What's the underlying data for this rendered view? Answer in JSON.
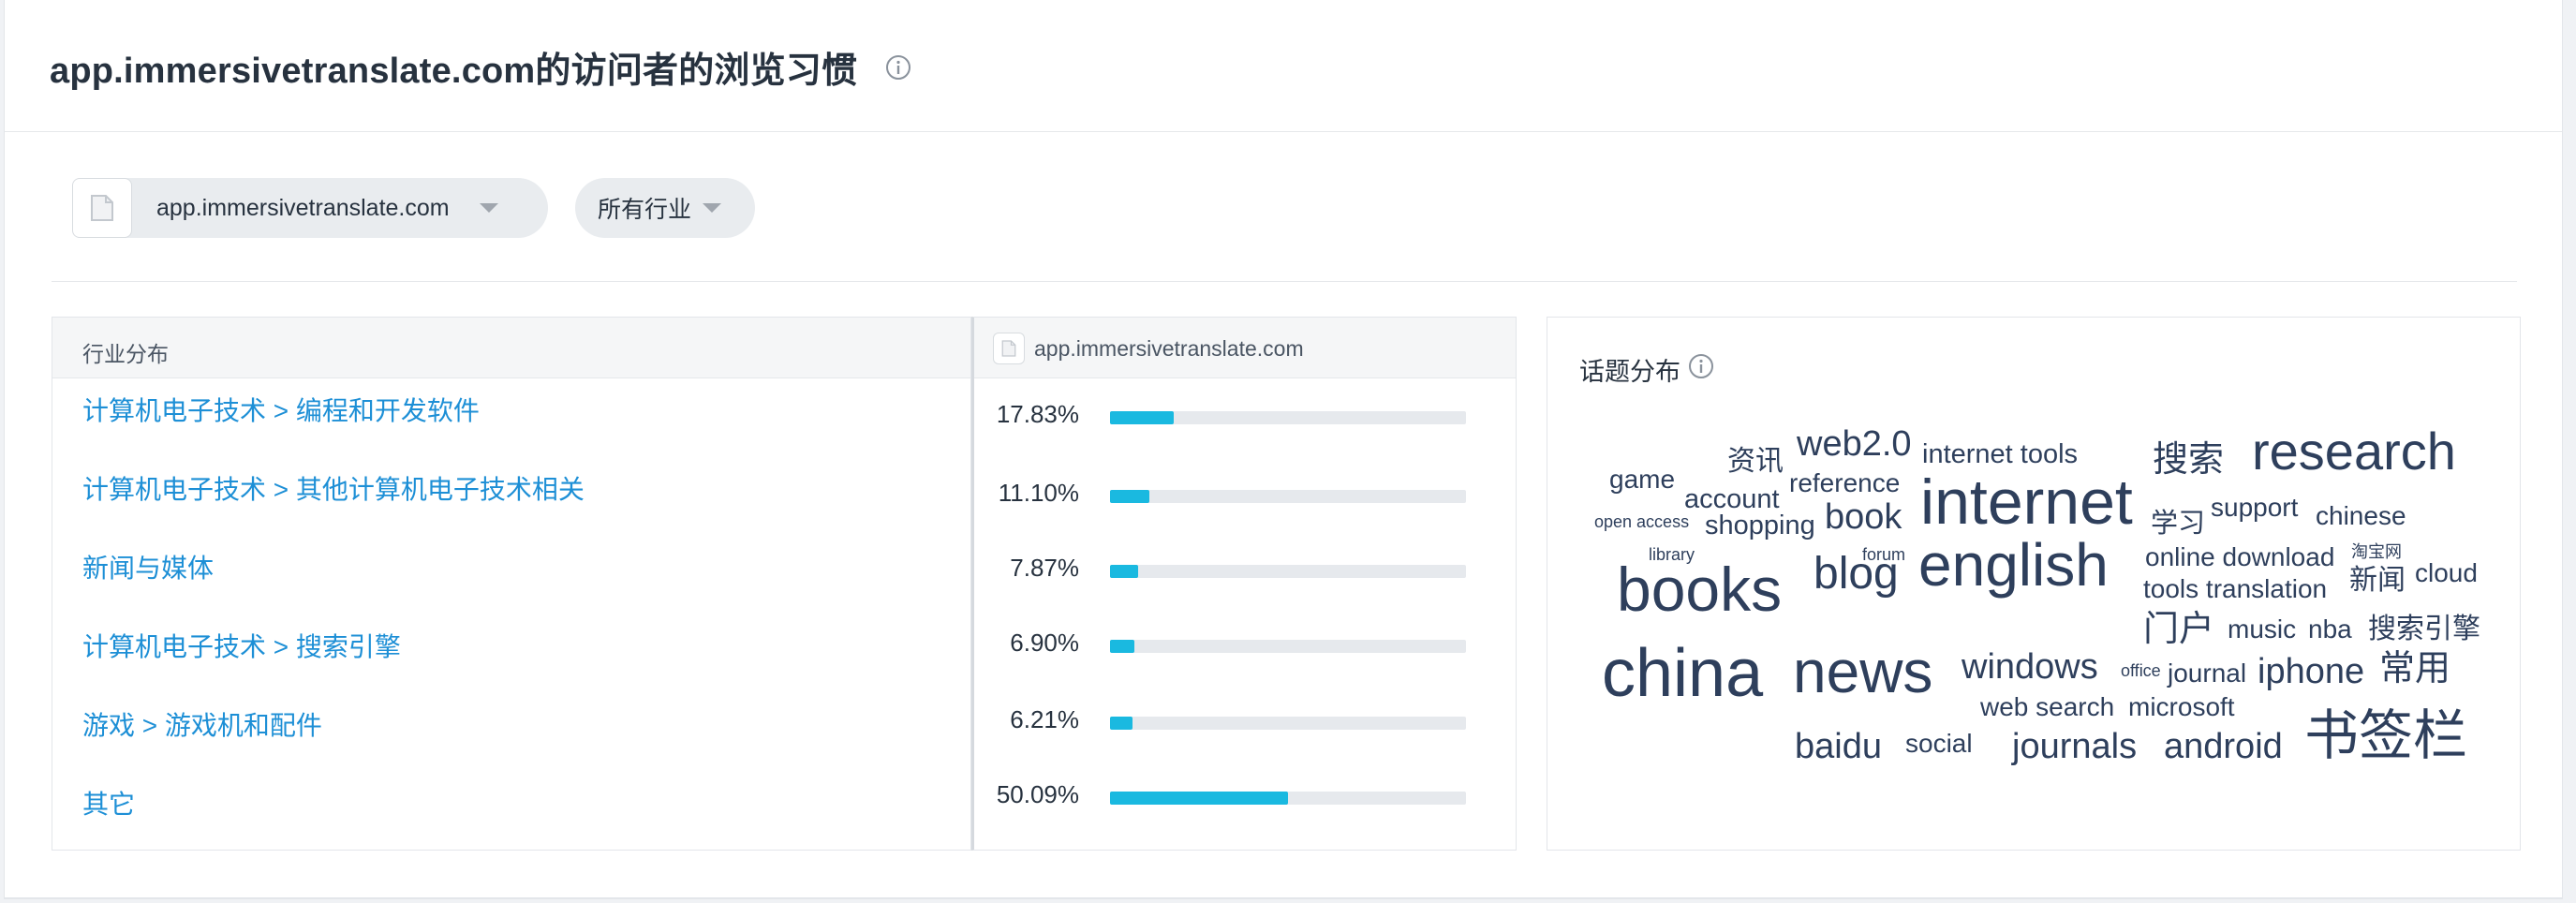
{
  "header": {
    "title": "app.immersivetranslate.com的访问者的浏览习惯"
  },
  "filters": {
    "site_select": "app.immersivetranslate.com",
    "industry_select": "所有行业"
  },
  "table": {
    "col_industry": "行业分布",
    "col_site": "app.immersivetranslate.com",
    "rows": [
      {
        "label": "计算机电子技术 > 编程和开发软件",
        "pct": "17.83%",
        "value": 17.83
      },
      {
        "label": "计算机电子技术 > 其他计算机电子技术相关",
        "pct": "11.10%",
        "value": 11.1
      },
      {
        "label": "新闻与媒体",
        "pct": "7.87%",
        "value": 7.87
      },
      {
        "label": "计算机电子技术 > 搜索引擎",
        "pct": "6.90%",
        "value": 6.9
      },
      {
        "label": "游戏 > 游戏机和配件",
        "pct": "6.21%",
        "value": 6.21
      },
      {
        "label": "其它",
        "pct": "50.09%",
        "value": 50.09
      }
    ]
  },
  "topics": {
    "title": "话题分布",
    "words": [
      "game",
      "资讯",
      "web2.0",
      "internet tools",
      "搜索",
      "research",
      "account",
      "reference",
      "internet",
      "open access",
      "shopping",
      "book",
      "学习",
      "support",
      "chinese",
      "library",
      "forum",
      "english",
      "online download",
      "淘宝网",
      "books",
      "blog",
      "tools translation",
      "新闻",
      "cloud",
      "门户",
      "music",
      "nba",
      "搜索引擎",
      "china",
      "news",
      "windows",
      "office",
      "journal",
      "iphone",
      "常用",
      "web search",
      "microsoft",
      "baidu",
      "social",
      "journals",
      "android",
      "书签栏"
    ]
  },
  "colors": {
    "accent_bar": "#1ab9e0",
    "link": "#1d8fd6",
    "word": "#2e3f5c"
  }
}
